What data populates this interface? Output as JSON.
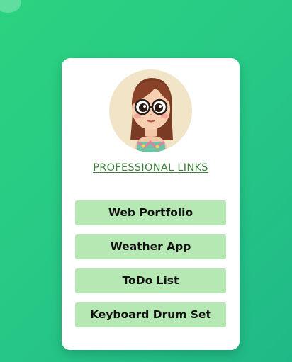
{
  "page": {
    "background_gradient": [
      "#2bd37f",
      "#1fb987"
    ]
  },
  "profile": {
    "avatar_icon": "cartoon-girl-with-glasses-avatar",
    "title": "PROFESSIONAL LINKS"
  },
  "links": [
    {
      "label": "Web Portfolio"
    },
    {
      "label": "Weather App"
    },
    {
      "label": "ToDo List"
    },
    {
      "label": "Keyboard Drum Set"
    }
  ],
  "colors": {
    "card": "#ffffff",
    "button": "#b6e8b4",
    "title": "#3f7f3c"
  }
}
